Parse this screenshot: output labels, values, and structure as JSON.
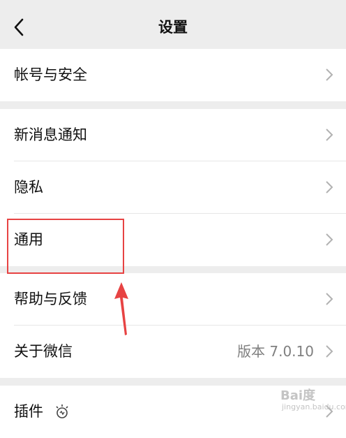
{
  "header": {
    "title": "设置",
    "back_icon": "chevron-left-icon"
  },
  "groups": [
    {
      "items": [
        {
          "label": "帐号与安全"
        }
      ]
    },
    {
      "items": [
        {
          "label": "新消息通知"
        },
        {
          "label": "隐私"
        },
        {
          "label": "通用"
        }
      ]
    },
    {
      "items": [
        {
          "label": "帮助与反馈"
        },
        {
          "label": "关于微信",
          "value": "版本 7.0.10"
        }
      ]
    },
    {
      "items": [
        {
          "label": "插件",
          "icon": "lightbulb-icon"
        }
      ]
    }
  ],
  "annotation": {
    "highlight_color": "#e74343",
    "highlighted_item": "通用"
  },
  "watermark": {
    "logo": "Bai度",
    "sub": "jingyan.baidu.com"
  }
}
